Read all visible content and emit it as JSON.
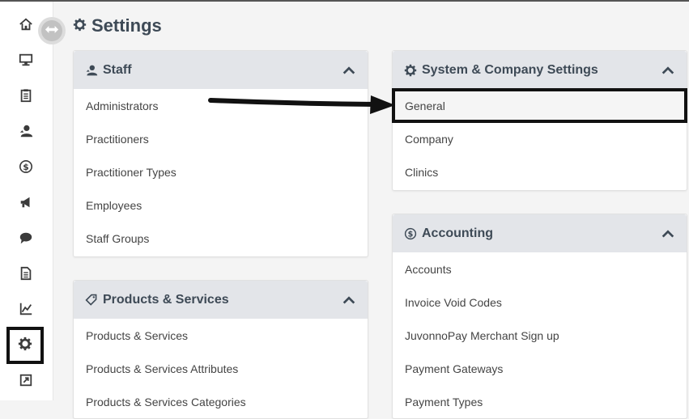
{
  "page": {
    "title": "Settings"
  },
  "sidebar": {
    "items": [
      {
        "icon": "home-icon",
        "active": false
      },
      {
        "icon": "monitor-icon",
        "active": false
      },
      {
        "icon": "clipboard-icon",
        "active": false
      },
      {
        "icon": "user-icon",
        "active": false
      },
      {
        "icon": "dollar-icon",
        "active": false
      },
      {
        "icon": "megaphone-icon",
        "active": false
      },
      {
        "icon": "chat-icon",
        "active": false
      },
      {
        "icon": "document-icon",
        "active": false
      },
      {
        "icon": "chart-icon",
        "active": false
      },
      {
        "icon": "gear-icon",
        "active": true
      },
      {
        "icon": "external-link-icon",
        "active": false
      }
    ]
  },
  "panels": {
    "staff": {
      "title": "Staff",
      "icon": "user-icon",
      "items": [
        "Administrators",
        "Practitioners",
        "Practitioner Types",
        "Employees",
        "Staff Groups"
      ]
    },
    "products": {
      "title": "Products & Services",
      "icon": "tag-icon",
      "items": [
        "Products & Services",
        "Products & Services Attributes",
        "Products & Services Categories"
      ]
    },
    "system": {
      "title": "System & Company Settings",
      "icon": "gear-icon",
      "items": [
        "General",
        "Company",
        "Clinics"
      ],
      "highlighted": "General"
    },
    "accounting": {
      "title": "Accounting",
      "icon": "dollar-icon",
      "items": [
        "Accounts",
        "Invoice Void Codes",
        "JuvonnoPay Merchant Sign up",
        "Payment Gateways",
        "Payment Types"
      ]
    }
  },
  "colors": {
    "header_bg": "#e3e5e9",
    "title_text": "#3e4a56",
    "annotation": "#111111"
  }
}
